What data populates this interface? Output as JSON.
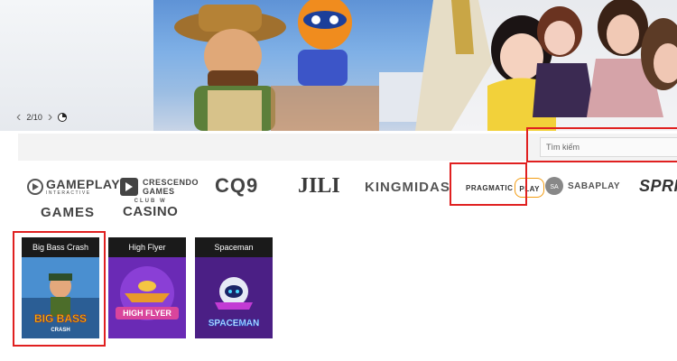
{
  "banner": {
    "pager": {
      "current": "2/10",
      "prev_icon": "chevron-left-icon",
      "next_icon": "chevron-right-icon",
      "timer_icon": "pie-timer-icon"
    }
  },
  "search": {
    "placeholder": "Tìm kiếm"
  },
  "providers": [
    {
      "name": "GAMEPLAY",
      "sub": "INTERACTIVE"
    },
    {
      "name": "CRESCENDO",
      "sub": "GAMES"
    },
    {
      "name": "CQ9"
    },
    {
      "name": "JILI"
    },
    {
      "name": "KINGMIDAS"
    },
    {
      "name": "PRAGMATIC",
      "sub": "PLAY"
    },
    {
      "name": "SABAPLAY"
    },
    {
      "name": "SPRIBE"
    },
    {
      "name": "GAMES"
    },
    {
      "name": "CLUB W",
      "sub": "CASINO"
    }
  ],
  "games": [
    {
      "name": "Big Bass Crash",
      "art_title": "BIG BASS",
      "art_sub": "CRASH"
    },
    {
      "name": "High Flyer",
      "art_title": "HIGH FLYER"
    },
    {
      "name": "Spaceman",
      "art_title": "SPACEMAN"
    }
  ],
  "colors": {
    "highlight": "#e02020",
    "searchbar_bg": "#f3f3f3"
  }
}
